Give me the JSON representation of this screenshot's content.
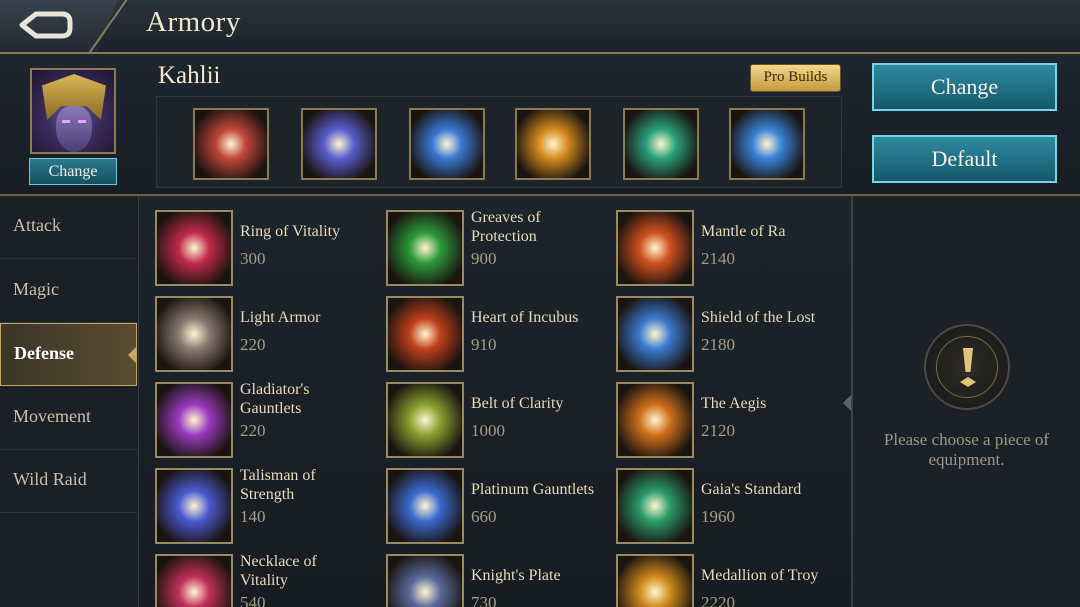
{
  "header": {
    "title": "Armory"
  },
  "hero": {
    "name": "Kahlii",
    "change_label": "Change",
    "pro_builds_label": "Pro Builds"
  },
  "actions": {
    "change_label": "Change",
    "default_label": "Default"
  },
  "equipped": [
    {
      "icon": "dagger-armor-icon",
      "color": "#c2453a"
    },
    {
      "icon": "boots-icon",
      "color": "#5a5ed0"
    },
    {
      "icon": "wand-icon",
      "color": "#3a78d4"
    },
    {
      "icon": "crown-icon",
      "color": "#d48a1e"
    },
    {
      "icon": "spellbook-icon",
      "color": "#2aa07a"
    },
    {
      "icon": "crystal-staff-icon",
      "color": "#3a82d8"
    }
  ],
  "categories": [
    {
      "label": "Attack",
      "active": false
    },
    {
      "label": "Magic",
      "active": false
    },
    {
      "label": "Defense",
      "active": true
    },
    {
      "label": "Movement",
      "active": false
    },
    {
      "label": "Wild Raid",
      "active": false
    }
  ],
  "items": [
    {
      "name": "Ring of Vitality",
      "price": "300",
      "icon": "ring-icon",
      "color": "#c02a4a"
    },
    {
      "name": "Greaves of Protection",
      "price": "900",
      "icon": "greaves-icon",
      "color": "#2a9a3a"
    },
    {
      "name": "Mantle of Ra",
      "price": "2140",
      "icon": "mantle-icon",
      "color": "#d0501e"
    },
    {
      "name": "Light Armor",
      "price": "220",
      "icon": "light-armor-icon",
      "color": "#8a7a70"
    },
    {
      "name": "Heart of Incubus",
      "price": "910",
      "icon": "heart-icon",
      "color": "#c0401a"
    },
    {
      "name": "Shield of the Lost",
      "price": "2180",
      "icon": "shield-icon",
      "color": "#3a7ad0"
    },
    {
      "name": "Gladiator's Gauntlets",
      "price": "220",
      "icon": "gauntlets-icon",
      "color": "#9a3ac0"
    },
    {
      "name": "Belt of Clarity",
      "price": "1000",
      "icon": "belt-icon",
      "color": "#8aa030"
    },
    {
      "name": "The Aegis",
      "price": "2120",
      "icon": "aegis-icon",
      "color": "#d0701a"
    },
    {
      "name": "Talisman of Strength",
      "price": "140",
      "icon": "talisman-icon",
      "color": "#4a5ad0"
    },
    {
      "name": "Platinum Gauntlets",
      "price": "660",
      "icon": "platinum-gauntlets-icon",
      "color": "#3a6ad0"
    },
    {
      "name": "Gaia's Standard",
      "price": "1960",
      "icon": "standard-icon",
      "color": "#2a9a6a"
    },
    {
      "name": "Necklace of Vitality",
      "price": "540",
      "icon": "necklace-icon",
      "color": "#c0305a"
    },
    {
      "name": "Knight's Plate",
      "price": "730",
      "icon": "plate-icon",
      "color": "#5a6a9a"
    },
    {
      "name": "Medallion of Troy",
      "price": "2220",
      "icon": "medallion-icon",
      "color": "#d08a1a"
    }
  ],
  "detail": {
    "message": "Please choose a piece of equipment."
  }
}
